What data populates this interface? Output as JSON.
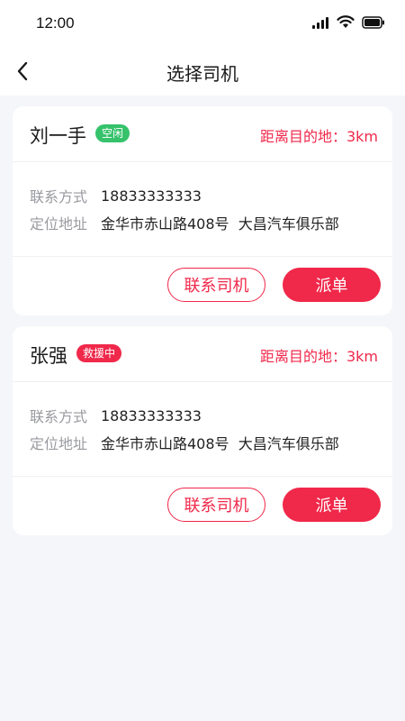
{
  "status_bar": {
    "time": "12:00"
  },
  "nav": {
    "title": "选择司机"
  },
  "drivers": [
    {
      "name": "刘一手",
      "status": "空闲",
      "distance": "距离目的地：3km",
      "phone_label": "联系方式",
      "phone": "18833333333",
      "address_label": "定位地址",
      "address": "金华市赤山路408号  大昌汽车俱乐部",
      "contact_label": "联系司机",
      "dispatch_label": "派单"
    },
    {
      "name": "张强",
      "status": "救援中",
      "distance": "距离目的地：3km",
      "phone_label": "联系方式",
      "phone": "18833333333",
      "address_label": "定位地址",
      "address": "金华市赤山路408号  大昌汽车俱乐部",
      "contact_label": "联系司机",
      "dispatch_label": "派单"
    }
  ],
  "colors": {
    "accent": "#f0284a",
    "idle": "#35c26b",
    "background": "#f5f6fa"
  }
}
